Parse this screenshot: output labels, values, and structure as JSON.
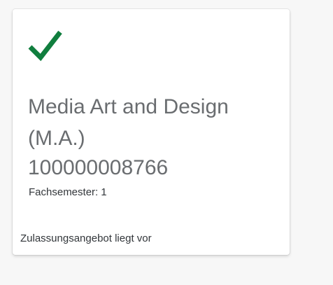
{
  "tile": {
    "status_icon": "checkmark-icon",
    "status_color": "#107e3e",
    "title": "Media Art and Design (M.A.)",
    "number": "100000008766",
    "semester_label": "Fachsemester:",
    "semester_value": "1",
    "footer": "Zulassungsangebot liegt vor"
  }
}
